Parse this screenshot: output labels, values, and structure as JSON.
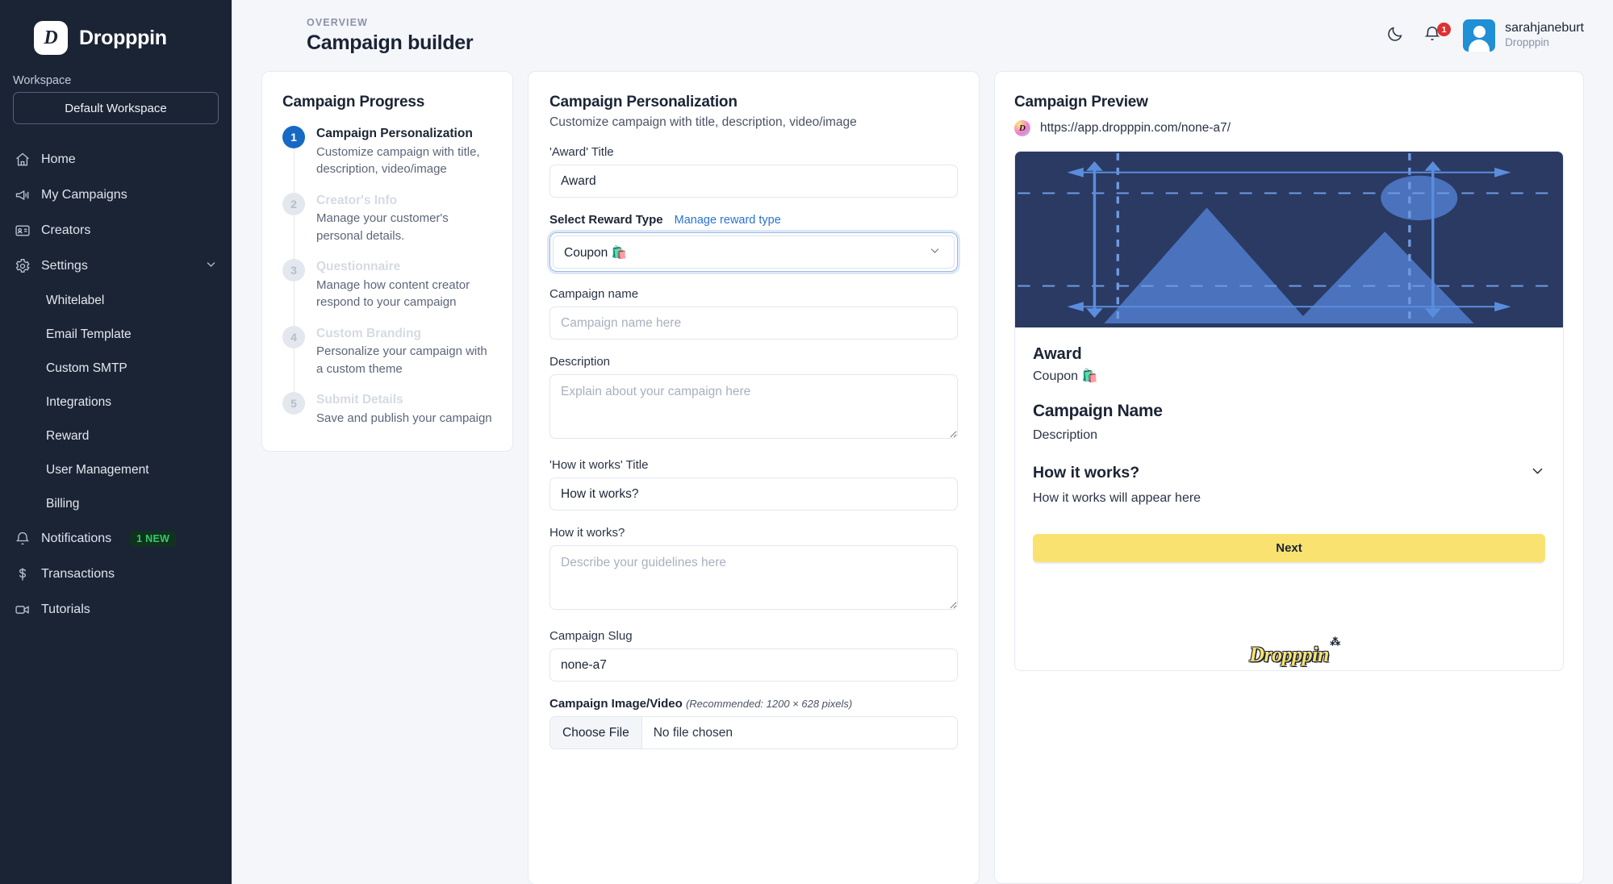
{
  "brand": {
    "name": "Dropppin",
    "mark": "D"
  },
  "sidebar": {
    "workspace_label": "Workspace",
    "workspace_value": "Default Workspace",
    "items": [
      {
        "label": "Home",
        "icon": "home-icon"
      },
      {
        "label": "My Campaigns",
        "icon": "megaphone-icon"
      },
      {
        "label": "Creators",
        "icon": "id-card-icon"
      },
      {
        "label": "Settings",
        "icon": "gear-icon",
        "chevron": "chevron-down-icon"
      }
    ],
    "settings_children": [
      {
        "label": "Whitelabel"
      },
      {
        "label": "Email Template"
      },
      {
        "label": "Custom SMTP"
      },
      {
        "label": "Integrations"
      },
      {
        "label": "Reward"
      },
      {
        "label": "User Management"
      },
      {
        "label": "Billing"
      }
    ],
    "items_bottom": [
      {
        "label": "Notifications",
        "icon": "bell-icon",
        "badge": "1 NEW"
      },
      {
        "label": "Transactions",
        "icon": "dollar-icon"
      },
      {
        "label": "Tutorials",
        "icon": "video-icon"
      }
    ]
  },
  "header": {
    "eyebrow": "OVERVIEW",
    "title": "Campaign builder",
    "theme_icon": "moon-icon",
    "notification_icon": "bell-icon",
    "notification_count": "1",
    "user_name": "sarahjaneburt",
    "user_org": "Dropppin"
  },
  "progress": {
    "title": "Campaign Progress",
    "steps": [
      {
        "num": "1",
        "title": "Campaign Personalization",
        "desc": "Customize campaign with title, description, video/image",
        "active": true
      },
      {
        "num": "2",
        "title": "Creator's Info",
        "desc": "Manage your customer's personal details.",
        "active": false
      },
      {
        "num": "3",
        "title": "Questionnaire",
        "desc": "Manage how content creator respond to your campaign",
        "active": false
      },
      {
        "num": "4",
        "title": "Custom Branding",
        "desc": "Personalize your campaign with a custom theme",
        "active": false
      },
      {
        "num": "5",
        "title": "Submit Details",
        "desc": "Save and publish your campaign",
        "active": false
      }
    ]
  },
  "form": {
    "title": "Campaign Personalization",
    "subtitle": "Customize campaign with title, description, video/image",
    "award_title_label": "'Award' Title",
    "award_title_value": "Award",
    "reward_type_label": "Select Reward Type",
    "manage_reward_link": "Manage reward type",
    "reward_type_value": "Coupon 🛍️",
    "campaign_name_label": "Campaign name",
    "campaign_name_placeholder": "Campaign name here",
    "description_label": "Description",
    "description_placeholder": "Explain about your campaign here",
    "how_title_label": "'How it works' Title",
    "how_title_value": "How it works?",
    "how_label": "How it works?",
    "how_placeholder": "Describe your guidelines here",
    "slug_label": "Campaign Slug",
    "slug_value": "none-a7",
    "media_label": "Campaign Image/Video",
    "media_hint": "(Recommended: 1200 × 628 pixels)",
    "choose_file_label": "Choose File",
    "no_file_label": "No file chosen"
  },
  "preview": {
    "title": "Campaign Preview",
    "url": "https://app.dropppin.com/none-a7/",
    "award": "Award",
    "reward_type": "Coupon 🛍️",
    "campaign_name": "Campaign Name",
    "description": "Description",
    "how_it_works_title": "How it works?",
    "how_it_works_text": "How it works will appear here",
    "next_label": "Next",
    "footer_logo": "Dropppin"
  },
  "colors": {
    "accent": "#1769c4",
    "link": "#2a72d4",
    "sidebar": "#1b2435",
    "cta": "#fae271",
    "badge_green": "#37c96a",
    "alert": "#e03131"
  }
}
